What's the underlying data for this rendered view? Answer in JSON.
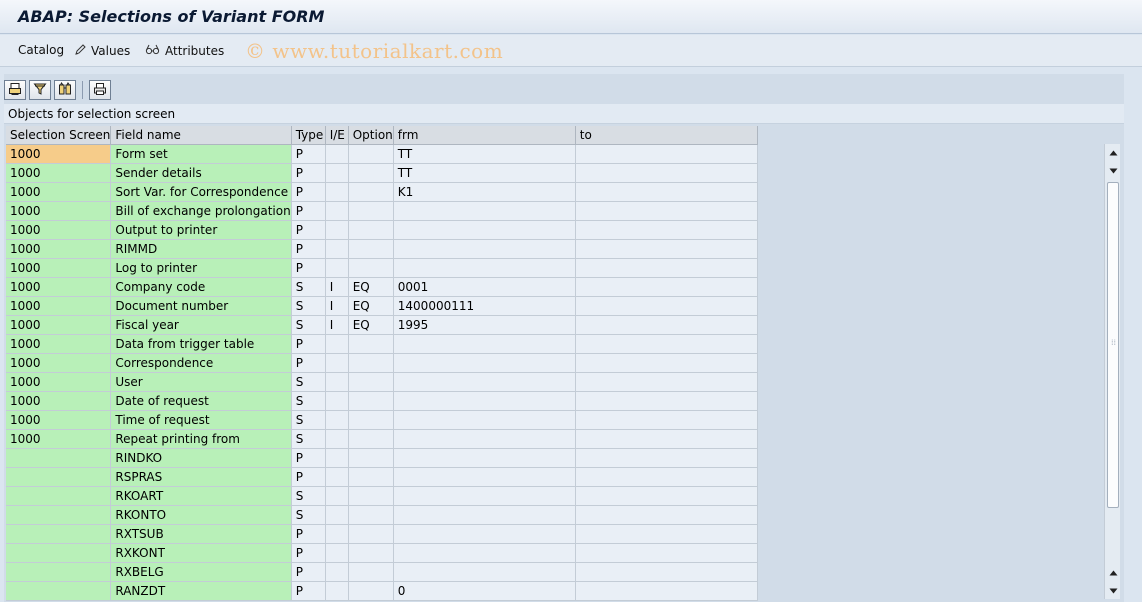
{
  "window": {
    "title": "ABAP: Selections of Variant FORM"
  },
  "menu": {
    "catalog": "Catalog",
    "values": "Values",
    "attributes": "Attributes"
  },
  "watermark": "© www.tutorialkart.com",
  "toolbar": {
    "icons": [
      "print-preview-icon",
      "filter-icon",
      "find-icon",
      "print-icon"
    ]
  },
  "caption": "Objects for selection screen",
  "columns": [
    "Selection Screen",
    "Field name",
    "Type",
    "I/E",
    "Option",
    "frm",
    "to"
  ],
  "rows": [
    {
      "screen": "1000",
      "field": "Form set",
      "type": "P",
      "ie": "",
      "option": "",
      "frm": "TT",
      "to": ""
    },
    {
      "screen": "1000",
      "field": "Sender details",
      "type": "P",
      "ie": "",
      "option": "",
      "frm": "TT",
      "to": ""
    },
    {
      "screen": "1000",
      "field": "Sort Var. for Correspondence",
      "type": "P",
      "ie": "",
      "option": "",
      "frm": "K1",
      "to": ""
    },
    {
      "screen": "1000",
      "field": "Bill of exchange prolongation",
      "type": "P",
      "ie": "",
      "option": "",
      "frm": "",
      "to": ""
    },
    {
      "screen": "1000",
      "field": "Output to printer",
      "type": "P",
      "ie": "",
      "option": "",
      "frm": "",
      "to": ""
    },
    {
      "screen": "1000",
      "field": "RIMMD",
      "type": "P",
      "ie": "",
      "option": "",
      "frm": "",
      "to": ""
    },
    {
      "screen": "1000",
      "field": "Log to printer",
      "type": "P",
      "ie": "",
      "option": "",
      "frm": "",
      "to": ""
    },
    {
      "screen": "1000",
      "field": "Company code",
      "type": "S",
      "ie": "I",
      "option": "EQ",
      "frm": "0001",
      "to": ""
    },
    {
      "screen": "1000",
      "field": "Document number",
      "type": "S",
      "ie": "I",
      "option": "EQ",
      "frm": "1400000111",
      "to": ""
    },
    {
      "screen": "1000",
      "field": "Fiscal year",
      "type": "S",
      "ie": "I",
      "option": "EQ",
      "frm": "1995",
      "to": ""
    },
    {
      "screen": "1000",
      "field": "Data from trigger table",
      "type": "P",
      "ie": "",
      "option": "",
      "frm": "",
      "to": ""
    },
    {
      "screen": "1000",
      "field": "Correspondence",
      "type": "P",
      "ie": "",
      "option": "",
      "frm": "",
      "to": ""
    },
    {
      "screen": "1000",
      "field": "User",
      "type": "S",
      "ie": "",
      "option": "",
      "frm": "",
      "to": ""
    },
    {
      "screen": "1000",
      "field": "Date of request",
      "type": "S",
      "ie": "",
      "option": "",
      "frm": "",
      "to": ""
    },
    {
      "screen": "1000",
      "field": "Time of request",
      "type": "S",
      "ie": "",
      "option": "",
      "frm": "",
      "to": ""
    },
    {
      "screen": "1000",
      "field": "Repeat printing from",
      "type": "S",
      "ie": "",
      "option": "",
      "frm": "",
      "to": ""
    },
    {
      "screen": "",
      "field": "RINDKO",
      "type": "P",
      "ie": "",
      "option": "",
      "frm": "",
      "to": ""
    },
    {
      "screen": "",
      "field": "RSPRAS",
      "type": "P",
      "ie": "",
      "option": "",
      "frm": "",
      "to": ""
    },
    {
      "screen": "",
      "field": "RKOART",
      "type": "S",
      "ie": "",
      "option": "",
      "frm": "",
      "to": ""
    },
    {
      "screen": "",
      "field": "RKONTO",
      "type": "S",
      "ie": "",
      "option": "",
      "frm": "",
      "to": ""
    },
    {
      "screen": "",
      "field": "RXTSUB",
      "type": "P",
      "ie": "",
      "option": "",
      "frm": "",
      "to": ""
    },
    {
      "screen": "",
      "field": "RXKONT",
      "type": "P",
      "ie": "",
      "option": "",
      "frm": "",
      "to": ""
    },
    {
      "screen": "",
      "field": "RXBELG",
      "type": "P",
      "ie": "",
      "option": "",
      "frm": "",
      "to": ""
    },
    {
      "screen": "",
      "field": "RANZDT",
      "type": "P",
      "ie": "",
      "option": "",
      "frm": "0",
      "to": ""
    }
  ],
  "colors": {
    "key_cell": "#b8f0b8",
    "selected_cell": "#f6cc8a",
    "grid_cell": "#e9eff6",
    "background": "#dbe5f0"
  }
}
